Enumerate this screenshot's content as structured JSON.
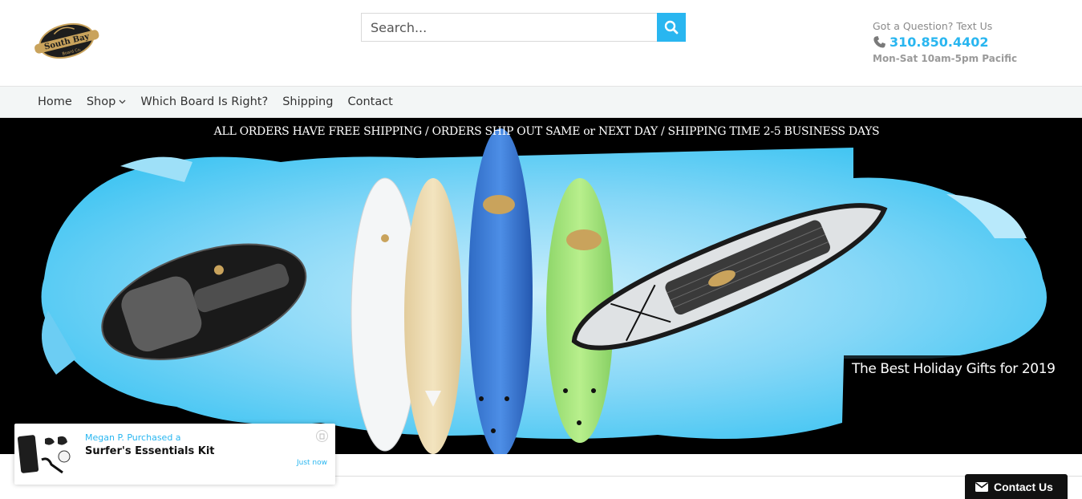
{
  "header": {
    "logo_alt": "South Bay Board Co.",
    "logo_text_line1": "South Bay",
    "logo_text_line2": "Board Co.",
    "search": {
      "placeholder": "Search..."
    },
    "contact": {
      "question": "Got a Question? Text Us",
      "phone": "310.850.4402",
      "hours": "Mon-Sat 10am-5pm Pacific"
    }
  },
  "nav": {
    "items": [
      {
        "label": "Home"
      },
      {
        "label": "Shop"
      },
      {
        "label": "Which Board Is Right?"
      },
      {
        "label": "Shipping"
      },
      {
        "label": "Contact"
      }
    ]
  },
  "banner": {
    "announcement": "ALL ORDERS HAVE FREE SHIPPING / ORDERS SHIP OUT SAME or NEXT DAY / SHIPPING TIME 2-5 BUSINESS DAYS",
    "promo": "The Best Holiday Gifts for 2019"
  },
  "popup": {
    "line1": "Megan P.  Purchased a",
    "product": "Surfer's Essentials Kit",
    "time": "Just now"
  },
  "contact_tab": {
    "label": "Contact Us"
  },
  "colors": {
    "accent": "#29b6f0",
    "nav_bg": "#f3f6f6",
    "banner_bg": "#000000",
    "splash": "#7fd3f5"
  },
  "icons": [
    "search-icon",
    "phone-icon",
    "chevron-down-icon",
    "close-icon",
    "envelope-icon"
  ]
}
